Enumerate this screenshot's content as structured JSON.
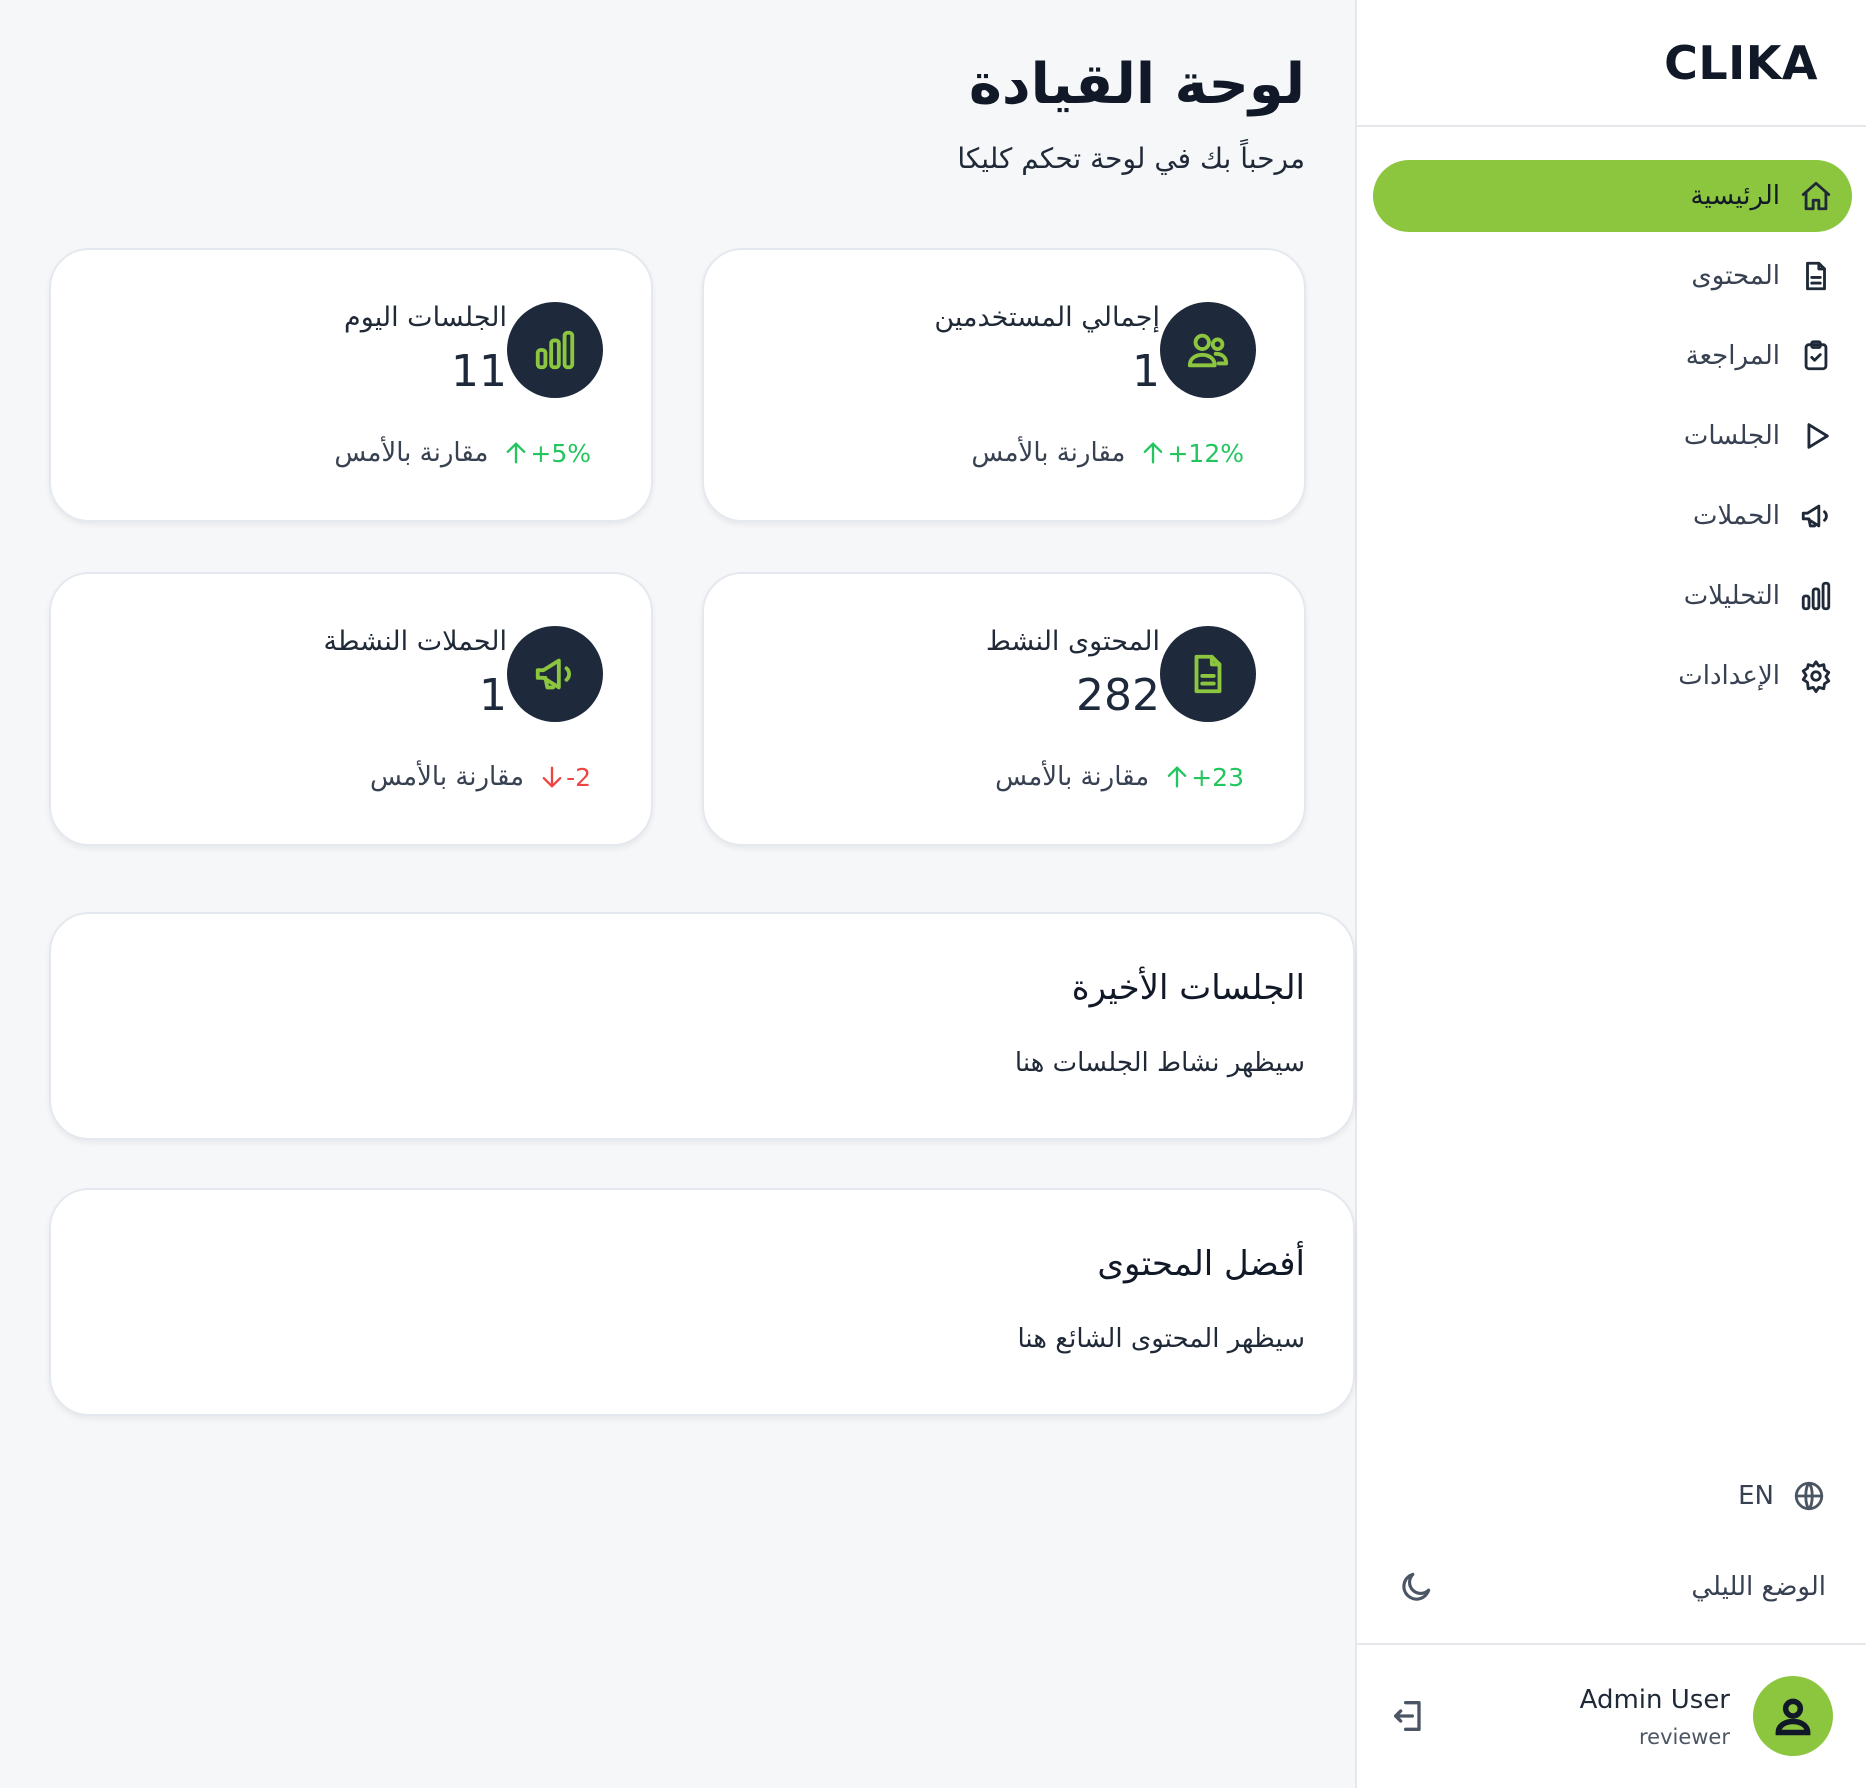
{
  "app": {
    "brand": "CLIKA"
  },
  "sidebar": {
    "items": [
      {
        "label": "الرئيسية",
        "icon": "home-icon",
        "active": true
      },
      {
        "label": "المحتوى",
        "icon": "document-icon",
        "active": false
      },
      {
        "label": "المراجعة",
        "icon": "clipboard-check-icon",
        "active": false
      },
      {
        "label": "الجلسات",
        "icon": "play-icon",
        "active": false
      },
      {
        "label": "الحملات",
        "icon": "megaphone-icon",
        "active": false
      },
      {
        "label": "التحليلات",
        "icon": "bar-chart-icon",
        "active": false
      },
      {
        "label": "الإعدادات",
        "icon": "gear-icon",
        "active": false
      }
    ],
    "language": "EN",
    "night_mode_label": "الوضع الليلي",
    "user": {
      "name": "Admin User",
      "role": "reviewer"
    }
  },
  "header": {
    "title": "لوحة القيادة",
    "subtitle": "مرحباً بك في لوحة تحكم كليكا"
  },
  "stats": [
    {
      "label": "إجمالي المستخدمين",
      "value": "1",
      "delta": "+12%",
      "direction": "up",
      "compare_text": "مقارنة بالأمس",
      "icon": "users-icon"
    },
    {
      "label": "الجلسات اليوم",
      "value": "11",
      "delta": "+5%",
      "direction": "up",
      "compare_text": "مقارنة بالأمس",
      "icon": "bar-chart-icon"
    },
    {
      "label": "المحتوى النشط",
      "value": "282",
      "delta": "+23",
      "direction": "up",
      "compare_text": "مقارنة بالأمس",
      "icon": "document-icon"
    },
    {
      "label": "الحملات النشطة",
      "value": "1",
      "delta": "-2",
      "direction": "down",
      "compare_text": "مقارنة بالأمس",
      "icon": "megaphone-icon"
    }
  ],
  "recent_sessions": {
    "title": "الجلسات الأخيرة",
    "empty_text": "سيظهر نشاط الجلسات هنا"
  },
  "top_content": {
    "title": "أفضل المحتوى",
    "empty_text": "سيظهر المحتوى الشائع هنا"
  },
  "colors": {
    "accent": "#8cc63f",
    "dark_circle": "#1e2a3b",
    "up": "#22c55e",
    "down": "#ef4444",
    "background": "#f6f7f9"
  }
}
